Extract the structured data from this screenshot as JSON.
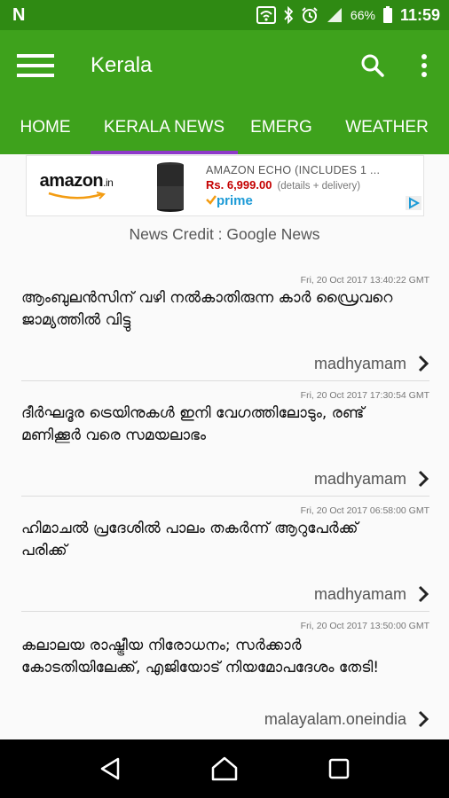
{
  "status_bar": {
    "notification_icon": "N",
    "battery": "66%",
    "time": "11:59"
  },
  "toolbar": {
    "title": "Kerala"
  },
  "tabs": [
    {
      "label": "HOME",
      "selected": false
    },
    {
      "label": "KERALA NEWS",
      "selected": true
    },
    {
      "label": "EMERG",
      "selected": false
    },
    {
      "label": "WEATHER",
      "selected": false
    }
  ],
  "ad": {
    "brand": "amazon",
    "brand_suffix": ".in",
    "product": "AMAZON ECHO (INCLUDES 1 ...",
    "price": "Rs. 6,999.00",
    "delivery": "(details + delivery)",
    "prime": "prime"
  },
  "credit": "News Credit : Google News",
  "news": [
    {
      "date": "Fri, 20 Oct 2017 13:40:22 GMT",
      "headline": "ആംബുലൻസിന് വഴി നൽകാതിരുന്ന കാർ ഡ്രൈവറെ ജാമ്യത്തിൽ വിട്ടു",
      "source": "madhyamam"
    },
    {
      "date": "Fri, 20 Oct 2017 17:30:54 GMT",
      "headline": "ദീർഘദൂര ട്രെയിനുകൾ ഇനി വേഗത്തിലോടും, രണ്ട് മണിക്കൂർ വരെ സമയലാഭം",
      "source": "madhyamam"
    },
    {
      "date": "Fri, 20 Oct 2017 06:58:00 GMT",
      "headline": "ഹിമാചൽ പ്രദേശിൽ പാലം തകർന്ന് ആറുപേർക്ക് പരിക്ക്",
      "source": "madhyamam"
    },
    {
      "date": "Fri, 20 Oct 2017 13:50:00 GMT",
      "headline": "കലാലയ രാഷ്ട്രീയ നിരോധനം; സർക്കാർ കോടതിയിലേക്ക്, എജിയോട് നിയമോപദേശം തേടി!",
      "source": "malayalam.oneindia"
    }
  ],
  "icons": {
    "menu": "hamburger-menu-icon",
    "search": "search-icon",
    "more": "more-vert-icon",
    "chevron": "chevron-right-icon",
    "back": "back-triangle-icon",
    "home": "home-icon",
    "recents": "recents-square-icon"
  },
  "colors": {
    "toolbar": "#3ea21c",
    "status_bar": "#2f8a13",
    "tab_indicator": "#8e39c9",
    "price": "#c40000",
    "prime": "#1c9ad6"
  }
}
